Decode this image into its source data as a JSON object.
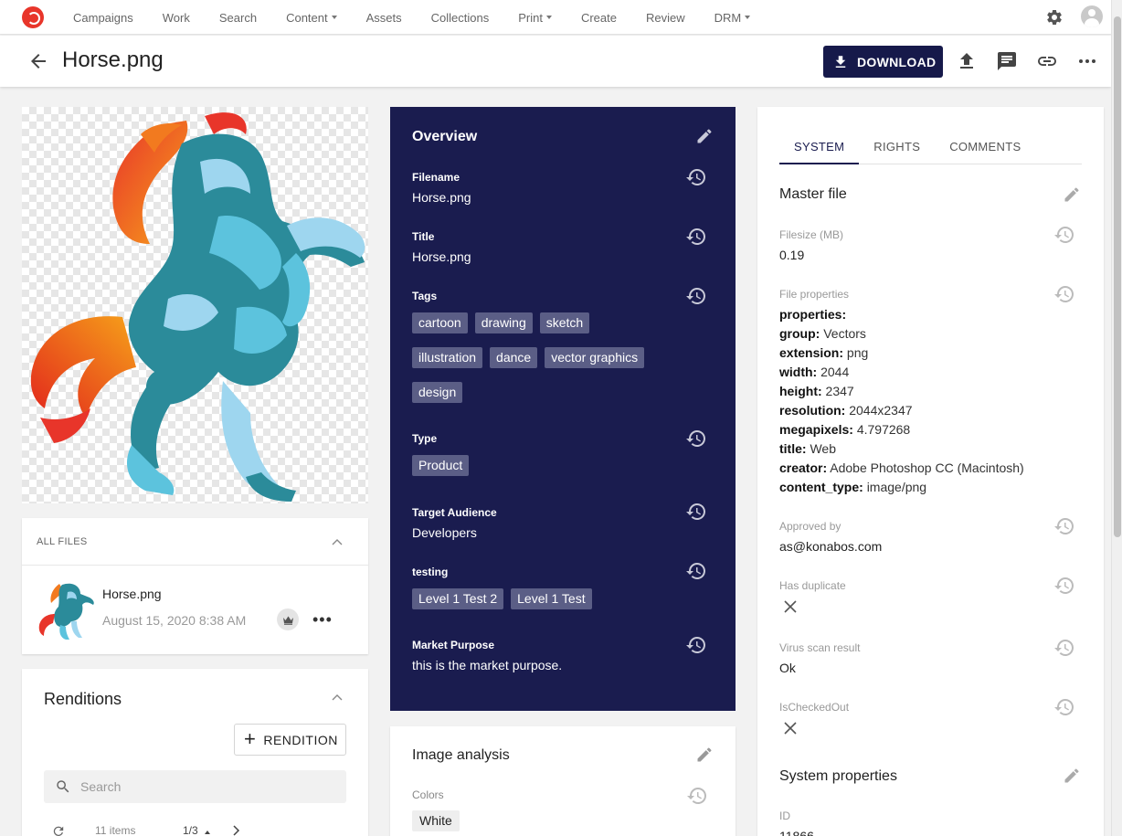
{
  "nav": {
    "items": [
      {
        "label": "Campaigns",
        "dropdown": false
      },
      {
        "label": "Work",
        "dropdown": false
      },
      {
        "label": "Search",
        "dropdown": false
      },
      {
        "label": "Content",
        "dropdown": true
      },
      {
        "label": "Assets",
        "dropdown": false
      },
      {
        "label": "Collections",
        "dropdown": false
      },
      {
        "label": "Print",
        "dropdown": true
      },
      {
        "label": "Create",
        "dropdown": false
      },
      {
        "label": "Review",
        "dropdown": false
      },
      {
        "label": "DRM",
        "dropdown": true
      }
    ]
  },
  "header": {
    "title": "Horse.png",
    "download_label": "DOWNLOAD"
  },
  "all_files": {
    "heading": "ALL FILES",
    "file_name": "Horse.png",
    "file_date": "August 15, 2020 8:38 AM"
  },
  "renditions": {
    "title": "Renditions",
    "add_label": "RENDITION",
    "search_placeholder": "Search",
    "count": "11 items",
    "page": "1/3"
  },
  "overview": {
    "title": "Overview",
    "fields": {
      "filename_label": "Filename",
      "filename": "Horse.png",
      "title_label": "Title",
      "title": "Horse.png",
      "tags_label": "Tags",
      "tags_row1": [
        "cartoon",
        "drawing",
        "sketch"
      ],
      "tags_row2": [
        "illustration",
        "dance",
        "vector graphics"
      ],
      "tags_row3": [
        "design"
      ],
      "type_label": "Type",
      "type": "Product",
      "audience_label": "Target Audience",
      "audience": "Developers",
      "testing_label": "testing",
      "testing_tags": [
        "Level 1 Test 2",
        "Level 1 Test"
      ],
      "market_label": "Market Purpose",
      "market": "this is the market purpose."
    }
  },
  "image_analysis": {
    "title": "Image analysis",
    "colors_label": "Colors",
    "color": "White"
  },
  "right_panel": {
    "tabs": [
      "SYSTEM",
      "RIGHTS",
      "COMMENTS"
    ],
    "active_tab": "SYSTEM",
    "master_file_title": "Master file",
    "filesize_label": "Filesize (MB)",
    "filesize": "0.19",
    "file_props_label": "File properties",
    "file_props_heading": "properties:",
    "file_props": [
      {
        "k": "group:",
        "v": "Vectors"
      },
      {
        "k": "extension:",
        "v": "png"
      },
      {
        "k": "width:",
        "v": "2044"
      },
      {
        "k": "height:",
        "v": "2347"
      },
      {
        "k": "resolution:",
        "v": "2044x2347"
      },
      {
        "k": "megapixels:",
        "v": "4.797268"
      },
      {
        "k": "title:",
        "v": "Web"
      },
      {
        "k": "creator:",
        "v": "Adobe Photoshop CC (Macintosh)"
      },
      {
        "k": "content_type:",
        "v": "image/png"
      }
    ],
    "approved_label": "Approved by",
    "approved": "as@konabos.com",
    "duplicate_label": "Has duplicate",
    "virus_label": "Virus scan result",
    "virus": "Ok",
    "checkedout_label": "IsCheckedOut",
    "system_props_title": "System properties",
    "id_label": "ID",
    "id": "11866"
  },
  "colors": {
    "brand": "#16194a",
    "overview_bg": "#1a1c4f",
    "tag_bg": "#5b5e86",
    "logo": "#e8352a"
  },
  "icons": [
    "settings-gear-icon",
    "user-avatar-icon",
    "back-arrow-icon",
    "download-icon",
    "upload-icon",
    "comment-icon",
    "link-icon",
    "more-icon",
    "edit-pencil-icon",
    "history-icon",
    "close-x-icon",
    "crown-icon",
    "search-icon",
    "refresh-icon"
  ]
}
